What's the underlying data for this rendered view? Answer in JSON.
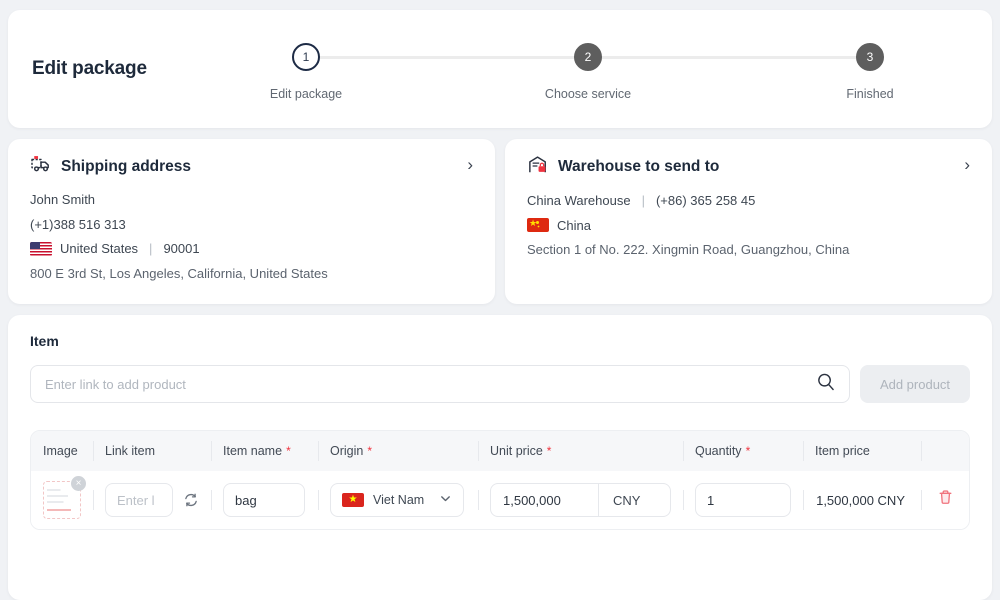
{
  "header": {
    "title": "Edit package",
    "steps": [
      {
        "number": "1",
        "label": "Edit package",
        "state": "active"
      },
      {
        "number": "2",
        "label": "Choose service",
        "state": "inactive"
      },
      {
        "number": "3",
        "label": "Finished",
        "state": "inactive"
      }
    ]
  },
  "shipping": {
    "title": "Shipping address",
    "icon": "delivery-truck-icon",
    "name": "John Smith",
    "phone": "(+1)388 516 313",
    "country": "United States",
    "postal": "90001",
    "address": "800 E 3rd St, Los Angeles, California, United States",
    "separator": "|",
    "chevron": "›"
  },
  "warehouse": {
    "title": "Warehouse to send to",
    "icon": "warehouse-lock-icon",
    "name": "China Warehouse",
    "phone": "(+86) 365 258 45",
    "country": "China",
    "address": "Section 1 of No. 222. Xingmin Road, Guangzhou, China",
    "separator": "|",
    "chevron": "›"
  },
  "item": {
    "section_title": "Item",
    "search_placeholder": "Enter link to add product",
    "search_value": "",
    "add_button": "Add product",
    "columns": [
      {
        "label": "Image",
        "required": false
      },
      {
        "label": "Link item",
        "required": false
      },
      {
        "label": "Item name",
        "required": true
      },
      {
        "label": "Origin",
        "required": true
      },
      {
        "label": "Unit price",
        "required": true
      },
      {
        "label": "Quantity",
        "required": true
      },
      {
        "label": "Item price",
        "required": false
      }
    ],
    "required_mark": "*",
    "rows": [
      {
        "link_placeholder": "Enter l",
        "link_value": "",
        "name_value": "bag",
        "origin_value": "Viet Nam",
        "origin_flag": "vn",
        "unit_price": "1,500,000",
        "currency": "CNY",
        "quantity": "1",
        "item_price": "1,500,000 CNY",
        "delete_icon": "trash-icon",
        "refresh_icon": "refresh-icon",
        "thumb_remove": "×"
      }
    ]
  },
  "colors": {
    "accent_red": "#f0333e",
    "step_active": "#1d2b45",
    "step_inactive": "#5e5e5e",
    "background": "#f0f2f5"
  }
}
